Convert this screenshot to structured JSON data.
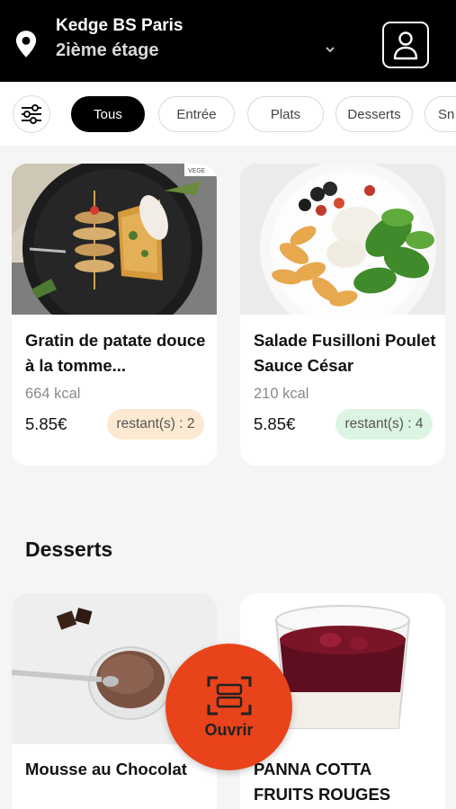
{
  "header": {
    "location_name": "Kedge BS Paris",
    "floor": "2ième étage",
    "icons": {
      "location": "map-pin-icon",
      "dropdown": "chevron-down-icon",
      "profile": "user-icon"
    }
  },
  "filters": {
    "icon": "sliders-icon",
    "chips": [
      {
        "label": "Tous",
        "active": true
      },
      {
        "label": "Entrée",
        "active": false
      },
      {
        "label": "Plats",
        "active": false
      },
      {
        "label": "Desserts",
        "active": false
      },
      {
        "label": "Sn",
        "active": false
      }
    ]
  },
  "products": [
    {
      "name": "Gratin de patate douce à la tomme...",
      "kcal": "664 kcal",
      "price": "5.85€",
      "stock": "restant(s) : 2",
      "stock_color": "#fde9d2",
      "tag": "VEGE"
    },
    {
      "name": "Salade Fusilloni Poulet Sauce César",
      "kcal": "210 kcal",
      "price": "5.85€",
      "stock": "restant(s) : 4",
      "stock_color": "#dcf5e2"
    }
  ],
  "desserts": {
    "section_title": "Desserts",
    "items": [
      {
        "name": "Mousse au Chocolat"
      },
      {
        "name": "PANNA COTTA FRUITS ROUGES"
      }
    ]
  },
  "open_button": {
    "label": "Ouvrir",
    "icon": "scan-icon",
    "color": "#e8431a"
  }
}
